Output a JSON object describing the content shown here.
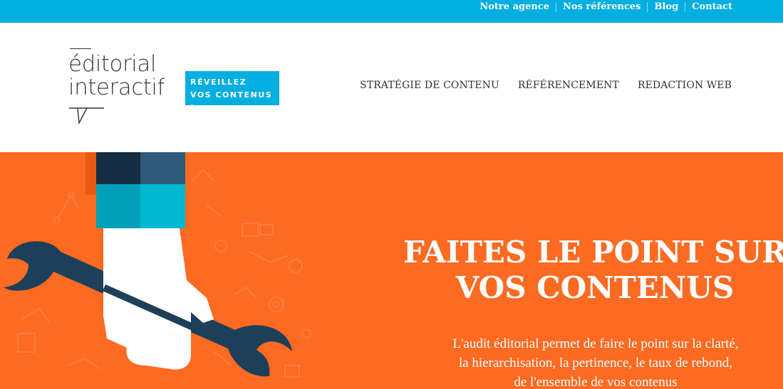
{
  "topbar": {
    "links": [
      "Notre agence",
      "Nos références",
      "Blog",
      "Contact"
    ],
    "color": "#03aee0"
  },
  "logo": {
    "line1": "éditorial",
    "line2": "interactif",
    "tagline1": "RÉVEILLEZ",
    "tagline2": "VOS CONTENUS !"
  },
  "mainnav": {
    "items": [
      "STRATÉGIE DE CONTENU",
      "RÉFÉRENCEMENT",
      "REDACTION WEB"
    ]
  },
  "hero": {
    "title1": "FAITES LE POINT SUR",
    "title2": "VOS CONTENUS",
    "desc1": "L'audit éditorial permet de faire le point sur la clarté,",
    "desc2": "la hierarchisation, la pertinence, le taux de rebond,",
    "desc3": "de l'ensemble de vos contenus",
    "color": "#fd6a22",
    "illustration_icon": "hand-holding-wrench-icon"
  }
}
